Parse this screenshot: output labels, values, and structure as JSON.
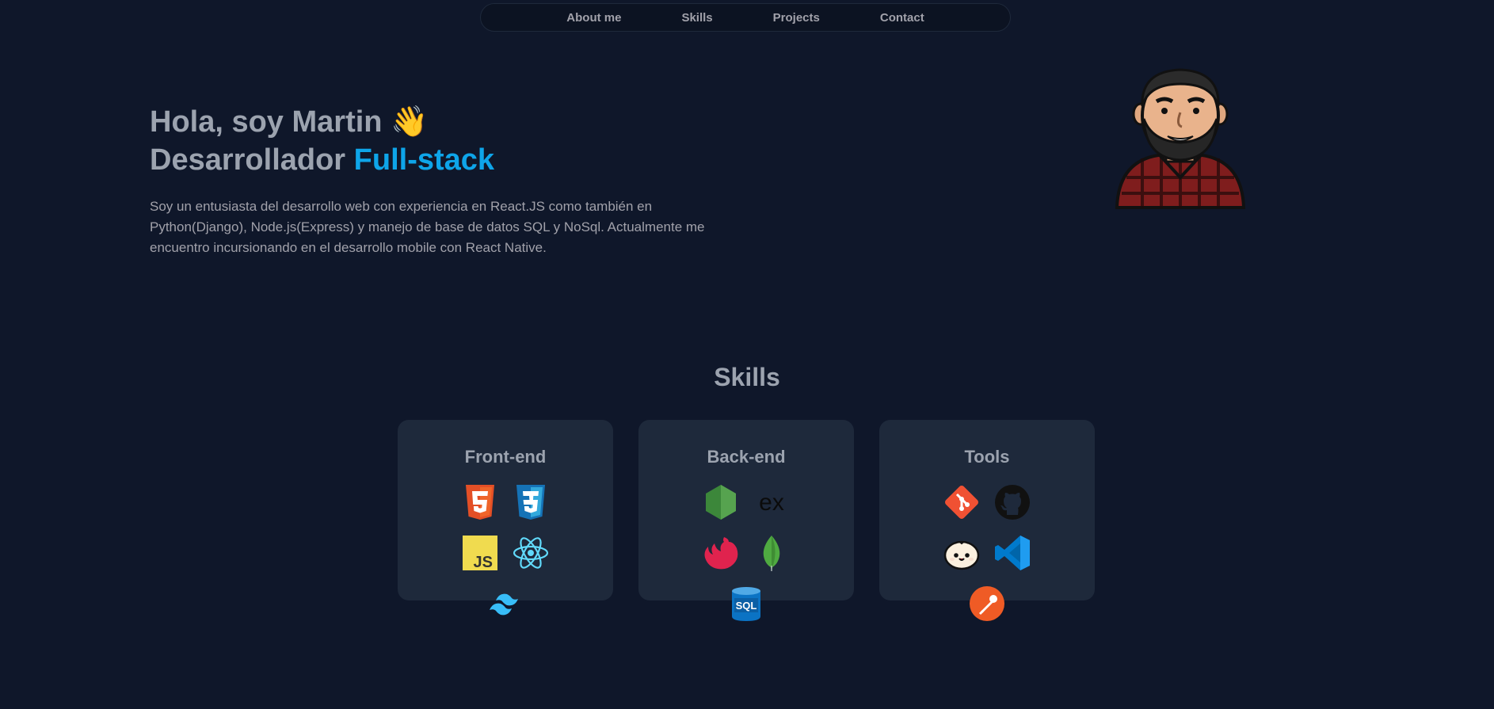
{
  "nav": {
    "items": [
      "About me",
      "Skills",
      "Projects",
      "Contact"
    ]
  },
  "hero": {
    "greeting": "Hola, soy Martin",
    "wave_emoji": "👋",
    "role_prefix": "Desarrollador",
    "role_accent": "Full-stack",
    "description": "Soy un entusiasta del desarrollo web con experiencia en React.JS como también en Python(Django), Node.js(Express) y manejo de base de datos SQL y NoSql. Actualmente me encuentro incursionando en el desarrollo mobile con React Native."
  },
  "skills": {
    "title": "Skills",
    "cards": [
      {
        "title": "Front-end",
        "icons": [
          "html5-icon",
          "css3-icon",
          "javascript-icon",
          "react-icon",
          "tailwind-icon"
        ]
      },
      {
        "title": "Back-end",
        "icons": [
          "nodejs-icon",
          "express-icon",
          "nestjs-icon",
          "mongodb-icon",
          "sql-database-icon"
        ]
      },
      {
        "title": "Tools",
        "icons": [
          "git-icon",
          "github-icon",
          "bun-icon",
          "vscode-icon",
          "postman-icon"
        ]
      }
    ]
  },
  "colors": {
    "background": "#0f172a",
    "card": "#1e293b",
    "accent": "#0ea5e9",
    "text": "#9ca3af"
  }
}
